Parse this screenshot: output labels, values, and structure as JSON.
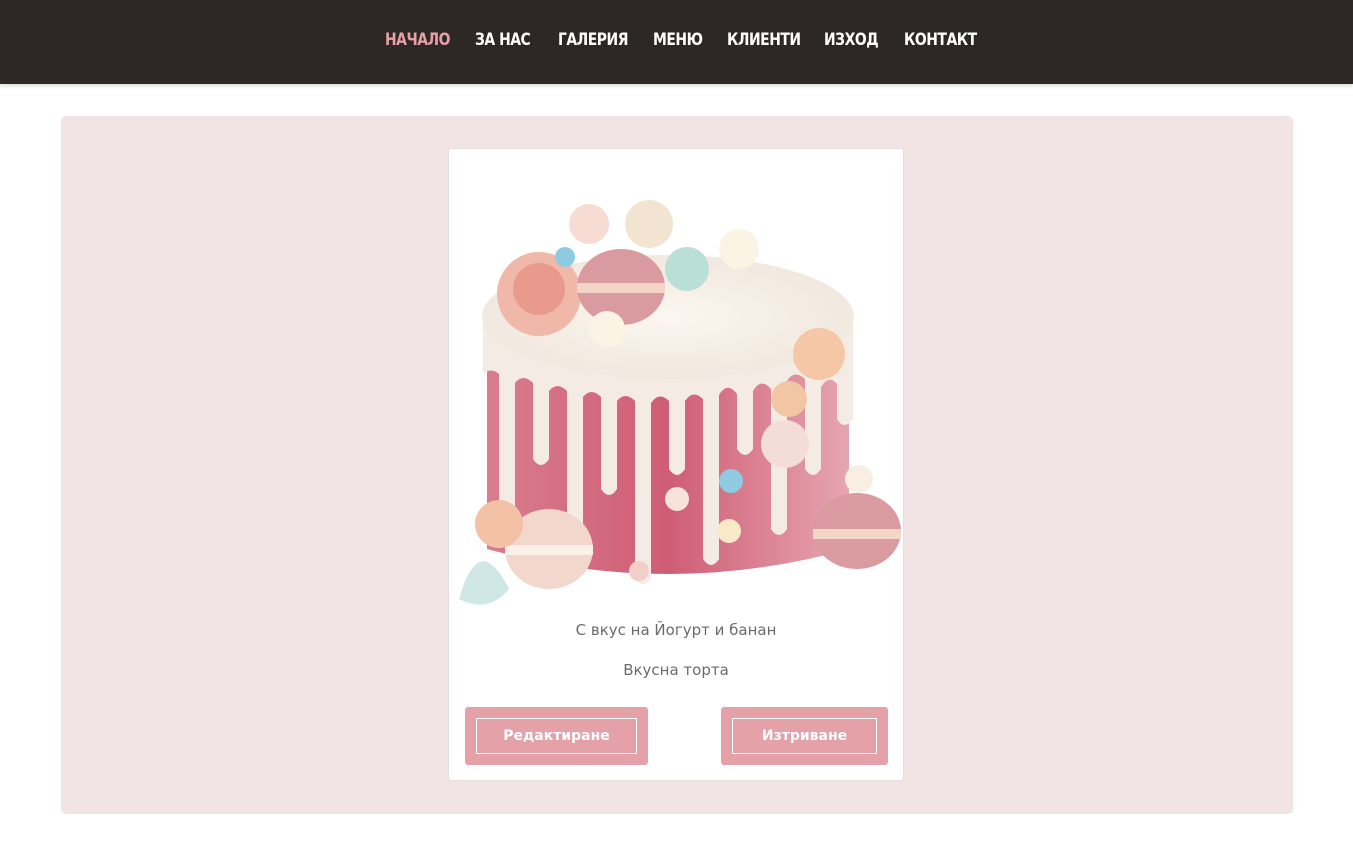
{
  "nav": {
    "items": [
      {
        "label": "НАЧАЛО",
        "active": true
      },
      {
        "label": "ЗА НАС",
        "active": false
      },
      {
        "label": "ГАЛЕРИЯ",
        "active": false
      },
      {
        "label": "МЕНЮ",
        "active": false
      },
      {
        "label": "КЛИЕНТИ",
        "active": false
      },
      {
        "label": "ИЗХОД",
        "active": false
      },
      {
        "label": "КОНТАКТ",
        "active": false
      }
    ]
  },
  "colors": {
    "navbar_bg": "#2d2825",
    "nav_active": "#e8a0a8",
    "panel_bg": "#f2e3e5",
    "button_bg": "#e4a1a8"
  },
  "card": {
    "image_icon": "cake-image",
    "title": "С вкус на Йогурт и банан",
    "description": "Вкусна торта",
    "edit_label": "Редактиране",
    "delete_label": "Изтриване"
  }
}
